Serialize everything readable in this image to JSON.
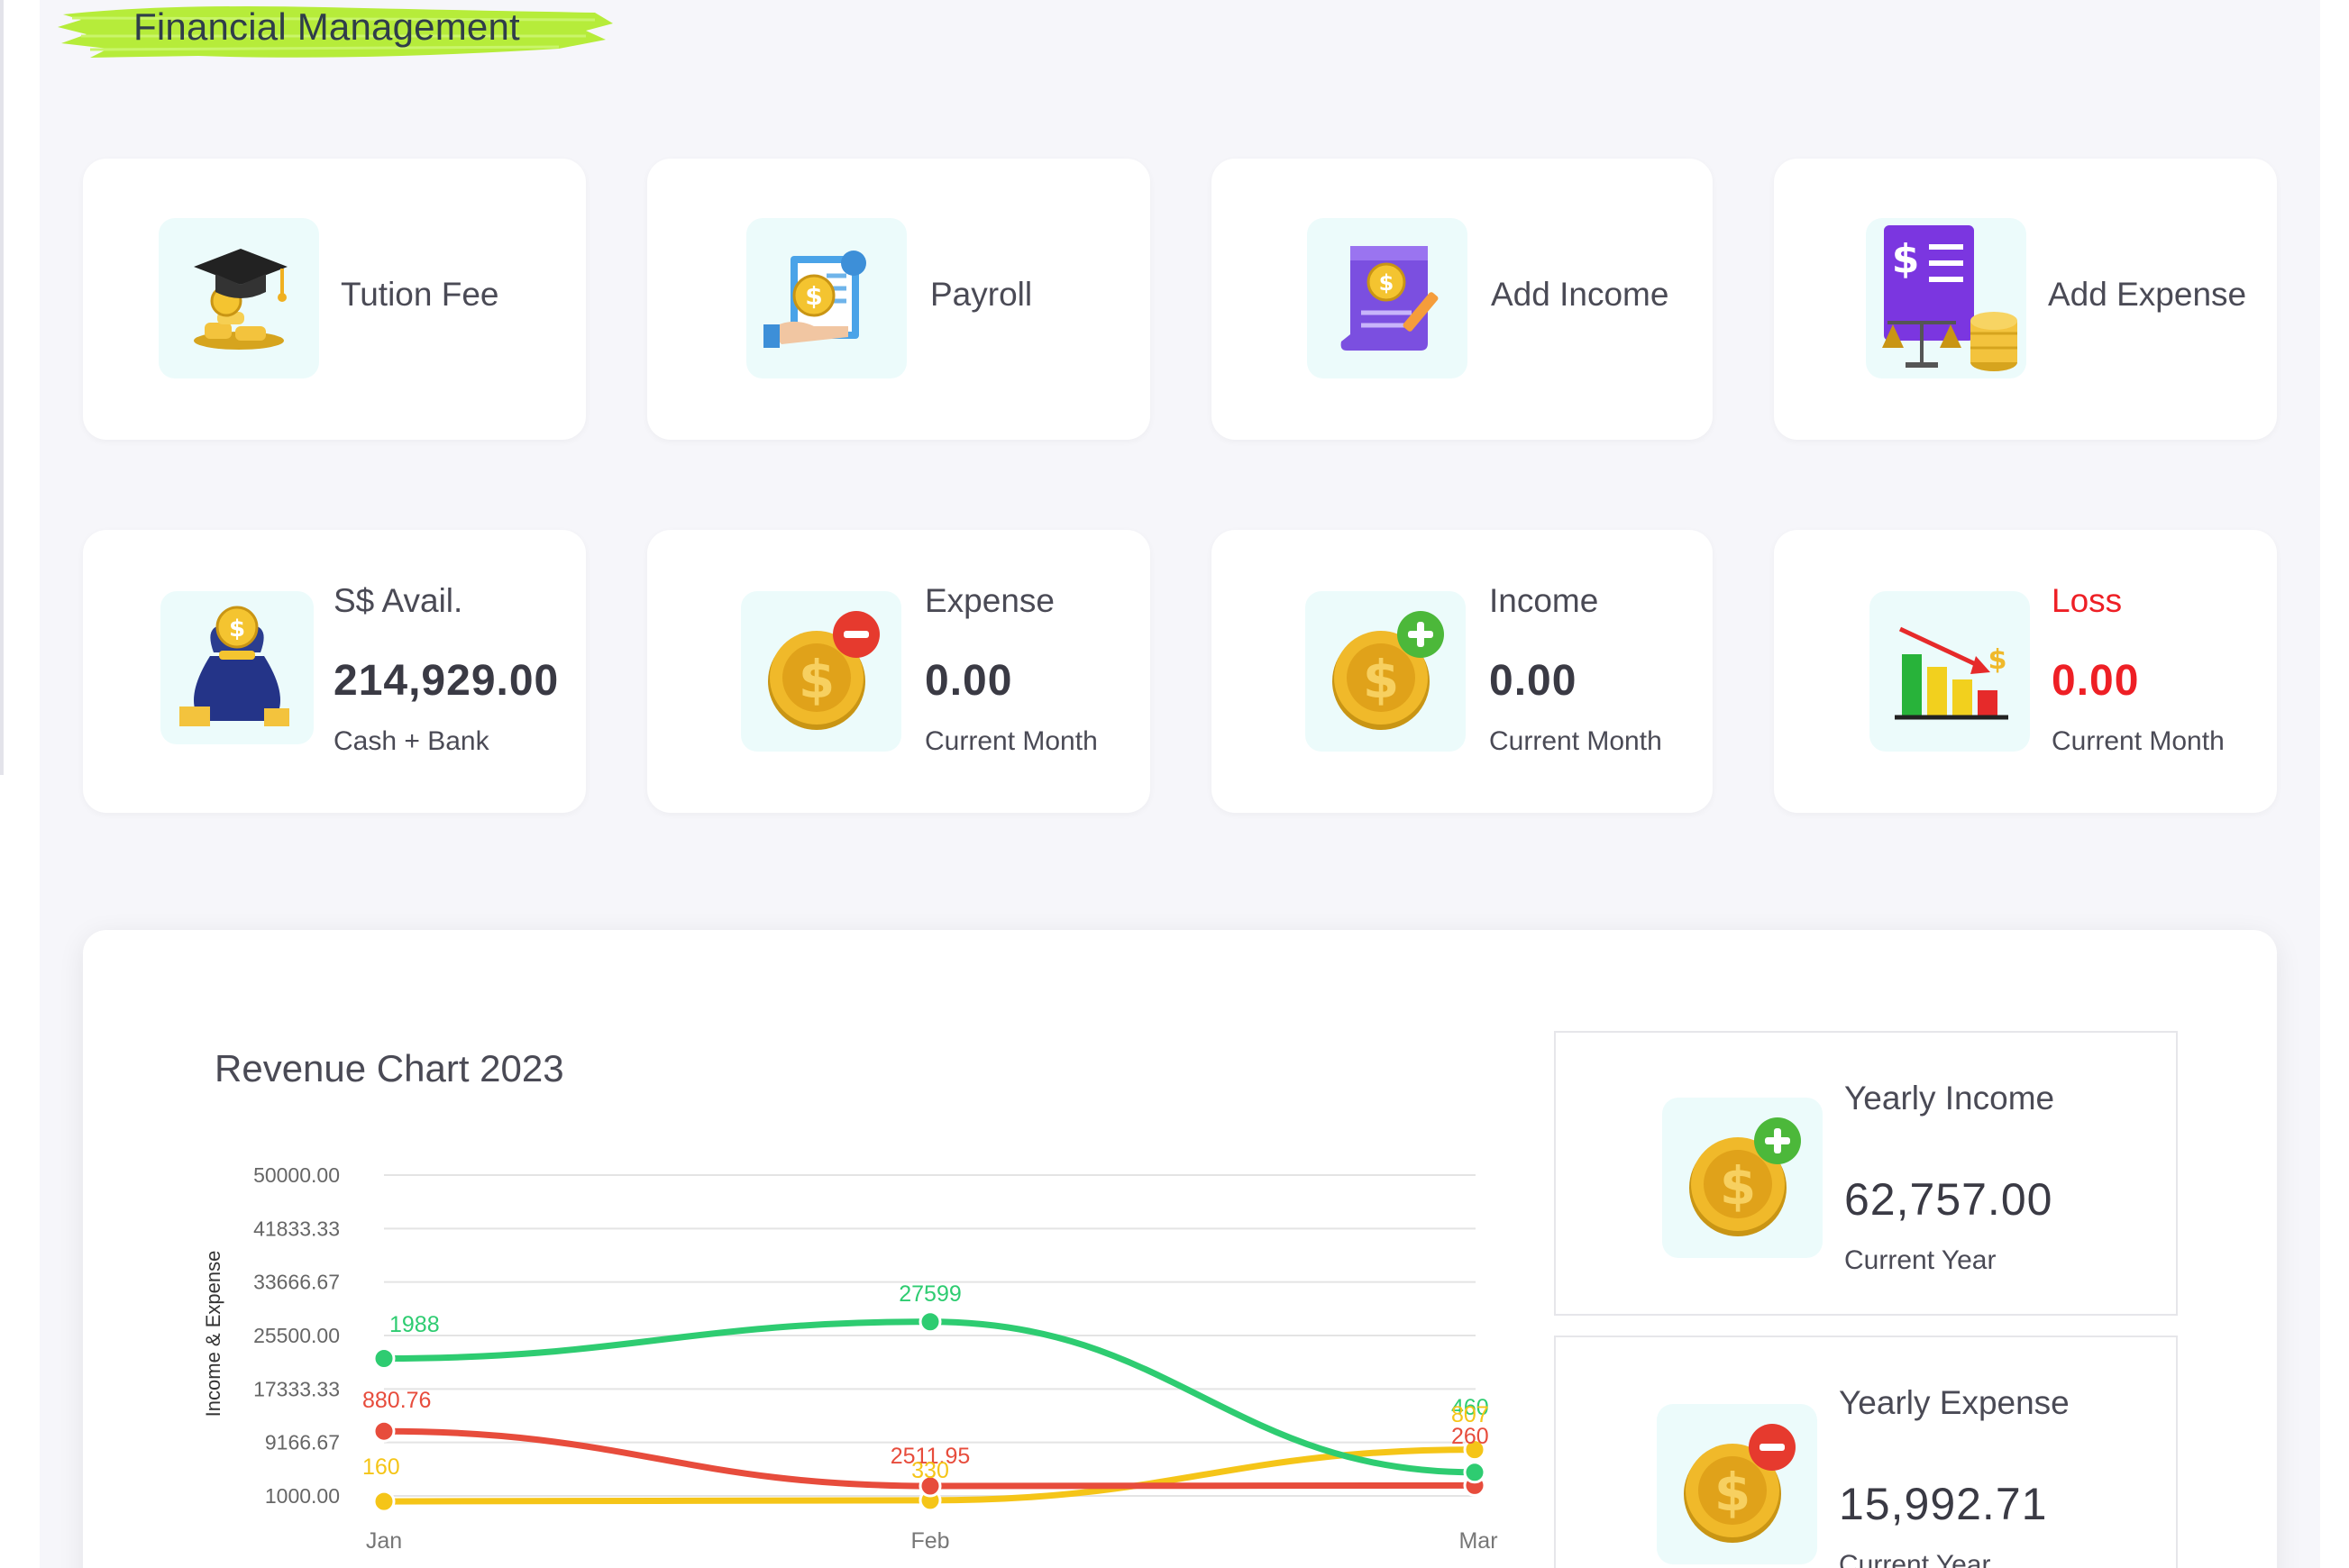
{
  "page": {
    "title": "Financial Management",
    "brush_color": "#b6ec3a"
  },
  "actions": [
    {
      "label": "Tution Fee",
      "icon": "graduation-cap-coins-icon"
    },
    {
      "label": "Payroll",
      "icon": "payroll-document-icon"
    },
    {
      "label": "Add Income",
      "icon": "income-document-icon"
    },
    {
      "label": "Add Expense",
      "icon": "expense-scale-icon"
    }
  ],
  "stats": [
    {
      "label": "S$ Avail.",
      "value": "214,929.00",
      "sub": "Cash + Bank",
      "icon": "money-bag-icon"
    },
    {
      "label": "Expense",
      "value": "0.00",
      "sub": "Current Month",
      "icon": "coin-minus-icon"
    },
    {
      "label": "Income",
      "value": "0.00",
      "sub": "Current Month",
      "icon": "coin-plus-icon"
    },
    {
      "label": "Loss",
      "value": "0.00",
      "sub": "Current Month",
      "icon": "bar-chart-down-icon",
      "color": "#ee1f25"
    }
  ],
  "yearly": {
    "income": {
      "label": "Yearly Income",
      "value": "62,757.00",
      "sub": "Current Year",
      "icon": "coin-plus-icon"
    },
    "expense": {
      "label": "Yearly Expense",
      "value": "15,992.71",
      "sub": "Current Year",
      "icon": "coin-minus-icon"
    }
  },
  "chart_data": {
    "type": "line",
    "title": "Revenue Chart 2023",
    "ylabel": "Income & Expense",
    "categories": [
      "Jan",
      "Feb",
      "Mar"
    ],
    "y_ticks": [
      "50000.00",
      "41833.33",
      "33666.67",
      "25500.00",
      "17333.33",
      "9166.67",
      "1000.00"
    ],
    "ylim": [
      1000,
      50000
    ],
    "grid": true,
    "series": [
      {
        "color": "#2ecc71",
        "values": [
          21988,
          27599,
          4605
        ],
        "labels": [
          "1988",
          "27599",
          "460"
        ]
      },
      {
        "color": "#e74c3c",
        "values": [
          10880.76,
          2511.95,
          2600
        ],
        "labels": [
          "880.76",
          "2511.95",
          "260"
        ]
      },
      {
        "color": "#f5c518",
        "values": [
          160,
          330,
          8075
        ],
        "labels": [
          "160",
          "330",
          "807"
        ]
      }
    ]
  }
}
